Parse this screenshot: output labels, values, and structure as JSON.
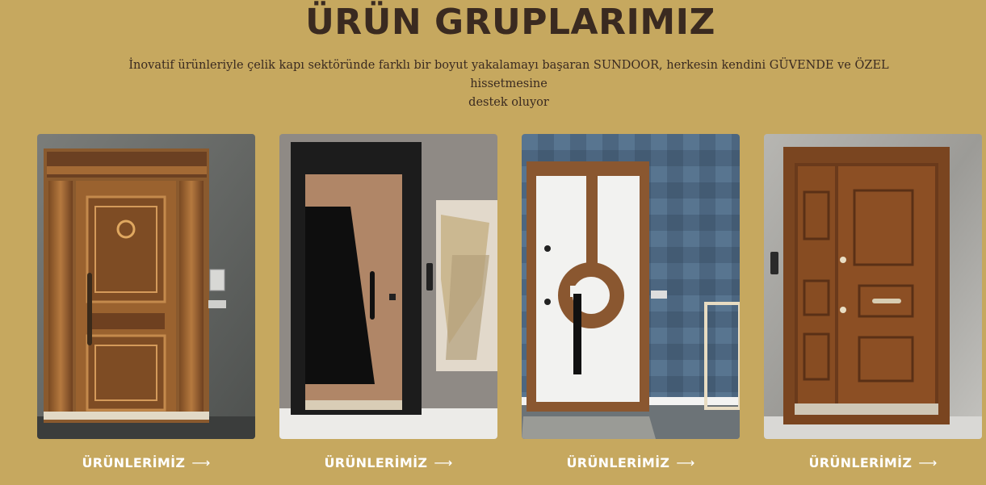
{
  "header": {
    "title": "ÜRÜN GRUPLARIMIZ",
    "description_line1": "İnovatif ürünleriyle çelik kapı sektöründe farklı bir boyut yakalamayı başaran SUNDOOR,  herkesin kendini GÜVENDE ve ÖZEL hissetmesine",
    "description_line2": "destek oluyor"
  },
  "products": [
    {
      "link_label": "ÜRÜNLERİMİZ",
      "arrow": "⟶"
    },
    {
      "link_label": "ÜRÜNLERİMİZ",
      "arrow": "⟶"
    },
    {
      "link_label": "ÜRÜNLERİMİZ",
      "arrow": "⟶"
    },
    {
      "link_label": "ÜRÜNLERİMİZ",
      "arrow": "⟶"
    }
  ],
  "colors": {
    "background": "#c6a85f",
    "heading": "#3a2a20",
    "link": "#ffffff"
  }
}
